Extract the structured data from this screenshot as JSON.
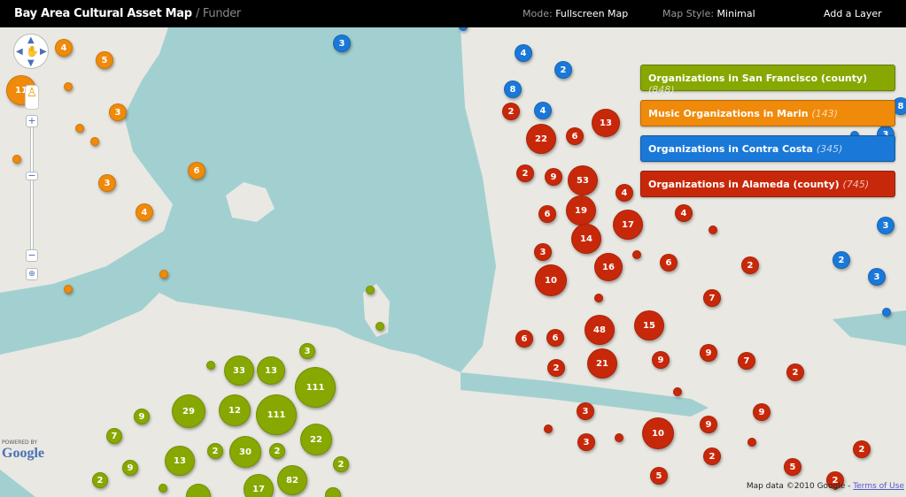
{
  "header": {
    "title": "Bay Area Cultural Asset Map",
    "subtitle": "/ Funder",
    "mode_label": "Mode:",
    "mode_value": "Fullscreen Map",
    "style_label": "Map Style:",
    "style_value": "Minimal",
    "add_layer": "Add a Layer"
  },
  "layers": [
    {
      "name": "Organizations in San Francisco (county)",
      "count": "(848)",
      "color": "#87a800",
      "markers": [
        "",
        "",
        "3",
        "",
        "33",
        "13",
        "111",
        "9",
        "29",
        "12",
        "111",
        "22",
        "7",
        "9",
        "13",
        "2",
        "30",
        "2",
        "2",
        "2",
        "",
        "",
        "17",
        "82",
        ""
      ]
    },
    {
      "name": "Music Organizations in Marin",
      "count": "(143)",
      "color": "#f08a0a",
      "markers": [
        "4",
        "5",
        "11",
        "",
        "3",
        "",
        "",
        "",
        "6",
        "3",
        "4",
        "",
        ""
      ]
    },
    {
      "name": "Organizations in Contra Costa",
      "count": "(345)",
      "color": "#1a78d8",
      "markers": [
        "3",
        "",
        "4",
        "2",
        "8",
        "4",
        "8",
        "",
        "3",
        "3",
        "2",
        "3",
        ""
      ]
    },
    {
      "name": "Organizations in Alameda (county)",
      "count": "(745)",
      "color": "#c8280a",
      "markers": [
        "2",
        "13",
        "22",
        "6",
        "2",
        "9",
        "53",
        "4",
        "6",
        "19",
        "17",
        "4",
        "",
        "14",
        "3",
        "",
        "16",
        "6",
        "2",
        "10",
        "",
        "7",
        "6",
        "6",
        "48",
        "15",
        "2",
        "21",
        "9",
        "9",
        "7",
        "2",
        "",
        "3",
        "9",
        "",
        "10",
        "9",
        "3",
        "",
        "",
        "2",
        "2",
        "5",
        "5",
        "2"
      ]
    }
  ],
  "controls": {
    "zoom_in": "+",
    "zoom_out": "−"
  },
  "google": {
    "powered_by": "POWERED BY",
    "logo": "Google"
  },
  "attribution": {
    "text": "Map data ©2010 Google - ",
    "terms": "Terms of Use"
  },
  "colors": {
    "land": "#e9e8e2",
    "water": "#a2d0d0"
  }
}
